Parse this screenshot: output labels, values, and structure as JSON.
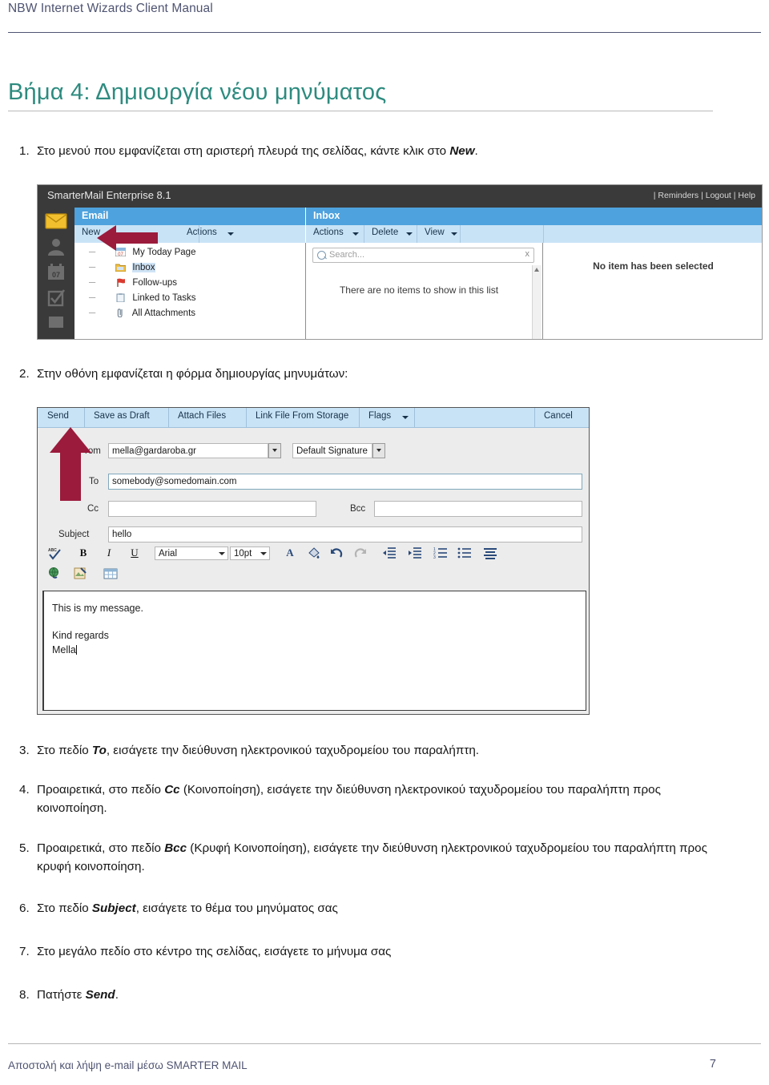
{
  "header": {
    "title": "NBW Internet Wizards Client Manual"
  },
  "section": {
    "title": "Βήμα 4: Δημιουργία νέου μηνύματος",
    "title_color": "#2d8b7f"
  },
  "steps": [
    {
      "num": "1.",
      "pre": "Στο μενού που εμφανίζεται στη αριστερή πλευρά της σελίδας, κάντε κλικ στο ",
      "strong": "New",
      "post": "."
    },
    {
      "num": "2.",
      "pre": "Στην οθόνη εμφανίζεται η φόρμα δημιουργίας μηνυμάτων:",
      "strong": "",
      "post": ""
    },
    {
      "num": "3.",
      "pre": "Στο πεδίο ",
      "strong": "To",
      "post": ", εισάγετε την διεύθυνση ηλεκτρονικού ταχυδρομείου του παραλήπτη."
    },
    {
      "num": "4.",
      "pre": "Προαιρετικά, στο πεδίο ",
      "strong": "Cc",
      "post": " (Κοινοποίηση), εισάγετε την διεύθυνση ηλεκτρονικού ταχυδρομείου του παραλήπτη προς κοινοποίηση."
    },
    {
      "num": "5.",
      "pre": "Προαιρετικά, στο πεδίο ",
      "strong": "Bcc",
      "post": " (Κρυφή Κοινοποίηση), εισάγετε την διεύθυνση ηλεκτρονικού ταχυδρομείου του παραλήπτη προς κρυφή κοινοποίηση."
    },
    {
      "num": "6.",
      "pre": "Στο πεδίο ",
      "strong": "Subject",
      "post": ", εισάγετε το θέμα του μηνύματος σας"
    },
    {
      "num": "7.",
      "pre": "Στο μεγάλο πεδίο στο κέντρο της σελίδας, εισάγετε το μήνυμα σας",
      "strong": "",
      "post": ""
    },
    {
      "num": "8.",
      "pre": "Πατήστε ",
      "strong": "Send",
      "post": "."
    }
  ],
  "screenshot_inbox": {
    "brand": "SmarterMail Enterprise 8.1",
    "top_links": "| Reminders | Logout | Help",
    "rail_icons": [
      "envelope-icon",
      "contact-icon",
      "calendar-icon",
      "tasks-icon",
      "notes-icon"
    ],
    "email_panel": {
      "title": "Email",
      "toolbar": [
        {
          "label": "New",
          "caret": false
        },
        {
          "label": "Actions",
          "caret": true
        }
      ],
      "tree": [
        {
          "label": "My Today Page",
          "icon": "calendar-day-icon",
          "selected": false
        },
        {
          "label": "Inbox",
          "icon": "inbox-folder-icon",
          "selected": true
        },
        {
          "label": "Follow-ups",
          "icon": "red-flag-icon",
          "selected": false
        },
        {
          "label": "Linked to Tasks",
          "icon": "clipboard-icon",
          "selected": false
        },
        {
          "label": "All Attachments",
          "icon": "paperclip-icon",
          "selected": false
        }
      ]
    },
    "list_panel": {
      "title": "Inbox",
      "toolbar": [
        {
          "label": "Actions",
          "caret": true
        },
        {
          "label": "Delete",
          "caret": true
        },
        {
          "label": "View",
          "caret": true
        }
      ],
      "search_placeholder": "Search...",
      "search_clear": "x",
      "empty_text": "There are no items to show in this list"
    },
    "preview_panel": {
      "empty_text": "No item has been selected"
    },
    "arrow": {
      "direction": "left",
      "color": "#9b1b3c",
      "points_at": "New"
    }
  },
  "screenshot_compose": {
    "toolbar": [
      {
        "label": "Send",
        "caret": false
      },
      {
        "label": "Save as Draft",
        "caret": false
      },
      {
        "label": "Attach Files",
        "caret": false
      },
      {
        "label": "Link File From Storage",
        "caret": false
      },
      {
        "label": "Flags",
        "caret": true
      },
      {
        "label": "Cancel",
        "caret": false
      }
    ],
    "fields": {
      "from_label": "From",
      "from_value": "mella@gardaroba.gr",
      "signature_value": "Default Signature",
      "to_label": "To",
      "to_value": "somebody@somedomain.com",
      "cc_label": "Cc",
      "cc_value": "",
      "bcc_label": "Bcc",
      "bcc_value": "",
      "subject_label": "Subject",
      "subject_value": "hello"
    },
    "editor": {
      "font_family_value": "Arial",
      "font_size_value": "10pt",
      "icons_row1": [
        "spellcheck-icon",
        "bold-icon",
        "italic-icon",
        "underline-icon",
        "font-color-icon",
        "highlight-icon",
        "undo-icon",
        "redo-icon",
        "outdent-icon",
        "indent-icon",
        "numbered-list-icon",
        "bullet-list-icon",
        "align-icon"
      ],
      "icons_row2": [
        "insert-link-icon",
        "insert-image-icon",
        "insert-table-icon"
      ]
    },
    "body_lines": [
      "This is my message.",
      "",
      "Kind regards",
      "Mella"
    ],
    "arrow": {
      "direction": "up",
      "color": "#9b1b3c",
      "points_at": "Send"
    }
  },
  "footer": {
    "text": "Αποστολή και λήψη e-mail μέσω SMARTER MAIL",
    "page": "7"
  }
}
